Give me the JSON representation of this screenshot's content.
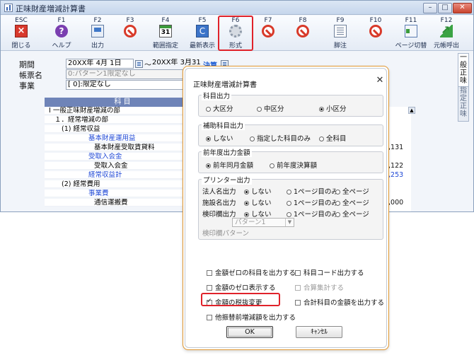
{
  "window": {
    "title": "正味財産増減計算書",
    "controls": {
      "minimize": "–",
      "maximize": "□",
      "close": "✕"
    }
  },
  "toolbar": {
    "keys": [
      {
        "key": "ESC",
        "label": "閉じる",
        "icon": "close-icon"
      },
      {
        "key": "F1",
        "label": "ヘルプ",
        "icon": "help-icon"
      },
      {
        "key": "F2",
        "label": "出力",
        "icon": "print-icon"
      },
      {
        "key": "F3",
        "label": "",
        "icon": "disabled-icon"
      },
      {
        "key": "F4",
        "label": "範囲指定",
        "icon": "calendar-icon",
        "icon_text": "31"
      },
      {
        "key": "F5",
        "label": "最新表示",
        "icon": "refresh-icon",
        "icon_text": "C"
      },
      {
        "key": "F6",
        "label": "形式",
        "icon": "gear-icon"
      },
      {
        "key": "F7",
        "label": "",
        "icon": "disabled-icon"
      },
      {
        "key": "F8",
        "label": "",
        "icon": "disabled-icon"
      },
      {
        "key": "F9",
        "label": "脚注",
        "icon": "document-icon"
      },
      {
        "key": "F10",
        "label": "",
        "icon": "disabled-icon"
      },
      {
        "key": "F11",
        "label": "ページ切替",
        "icon": "page-switch-icon"
      },
      {
        "key": "F12",
        "label": "元帳呼出",
        "icon": "ledger-arrow-icon"
      }
    ]
  },
  "header": {
    "period_label": "期間",
    "period_from": "20XX年 4月 1日",
    "period_tilde": "～",
    "period_to": "20XX年 3月31日",
    "settlement_link": "決算",
    "form_label": "帳票名",
    "form_value": "0:パターン1限定なし",
    "business_label": "事業",
    "business_value": "[     0]:限定なし"
  },
  "grid": {
    "column_header": "科 目",
    "rows": [
      {
        "text": "Ⅰ 一般正味財産増減の部",
        "indent": 0,
        "blue": false,
        "amount": ""
      },
      {
        "text": "１．経常増減の部",
        "indent": 1,
        "blue": false,
        "amount": ""
      },
      {
        "text": "(1) 経常収益",
        "indent": 2,
        "blue": false,
        "amount": ""
      },
      {
        "text": "基本財産運用益",
        "indent": 3,
        "blue": true,
        "amount": ""
      },
      {
        "text": "基本財産受取賃貸料",
        "indent": 4,
        "blue": false,
        "amount": ",131"
      },
      {
        "text": "受取入会金",
        "indent": 3,
        "blue": true,
        "amount": ""
      },
      {
        "text": "受取入会金",
        "indent": 4,
        "blue": false,
        "amount": ",122"
      },
      {
        "text": "経常収益計",
        "indent": 3,
        "blue": true,
        "amount": ",253"
      },
      {
        "text": "(2) 経常費用",
        "indent": 2,
        "blue": false,
        "amount": ""
      },
      {
        "text": "事業費",
        "indent": 3,
        "blue": true,
        "amount": ""
      },
      {
        "text": "通信運搬費",
        "indent": 4,
        "blue": false,
        "amount": ",000"
      }
    ]
  },
  "side_tabs": {
    "general": "一般正味",
    "designated": "指定正味"
  },
  "dialog": {
    "title": "正味財産増減計算書",
    "close": "✕",
    "account_output": {
      "legend": "科目出力",
      "options": [
        "大区分",
        "中区分",
        "小区分"
      ],
      "selected": 2
    },
    "supplementary_output": {
      "legend": "補助科目出力",
      "options": [
        "しない",
        "指定した科目のみ",
        "全科目"
      ],
      "selected": 0
    },
    "prior_year": {
      "legend": "前年度出力金額",
      "options": [
        "前年同月金額",
        "前年度決算額"
      ],
      "selected": 0
    },
    "printer_output": {
      "legend": "プリンター出力",
      "rows": [
        {
          "label": "法人名出力",
          "options": [
            "しない",
            "1ページ目のみ",
            "全ページ"
          ],
          "selected": 0
        },
        {
          "label": "施設名出力",
          "options": [
            "しない",
            "1ページ目のみ",
            "全ページ"
          ],
          "selected": 0
        },
        {
          "label": "検印欄出力",
          "options": [
            "しない",
            "1ページ目のみ",
            "全ページ"
          ],
          "selected": 0
        }
      ],
      "stamp_pattern_label": "検印欄パターン",
      "stamp_pattern_value": "パターン1"
    },
    "checkboxes": {
      "zero_accounts": "金額ゼロの科目を出力する",
      "account_code": "科目コード出力する",
      "zero_display": "金額のゼロ表示する",
      "combined_total": "合算集計する",
      "tax_change": "金額の税抜変更",
      "total_accounts": "合計科目の金額を出力する",
      "other_transfer": "他振替前増減額を出力する"
    },
    "buttons": {
      "ok": "OK",
      "cancel": "ｷｬﾝｾﾙ"
    }
  }
}
